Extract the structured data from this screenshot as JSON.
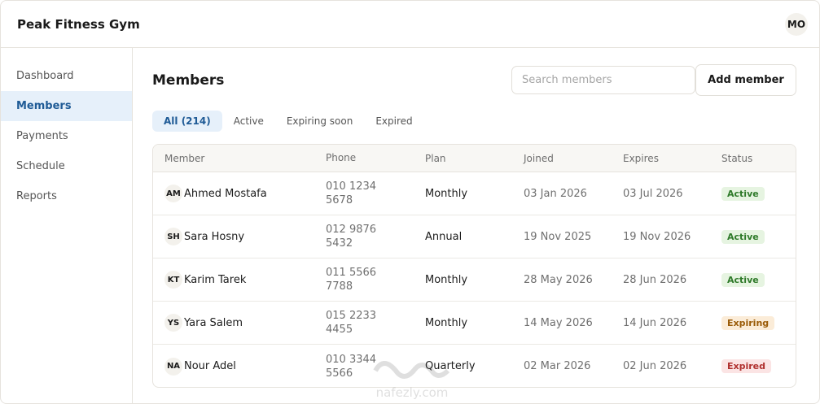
{
  "header": {
    "title": "Peak Fitness Gym",
    "user_initials": "MO"
  },
  "sidebar": {
    "items": [
      {
        "label": "Dashboard",
        "active": false
      },
      {
        "label": "Members",
        "active": true
      },
      {
        "label": "Payments",
        "active": false
      },
      {
        "label": "Schedule",
        "active": false
      },
      {
        "label": "Reports",
        "active": false
      }
    ]
  },
  "main": {
    "title": "Members",
    "search": {
      "placeholder": "Search members",
      "value": ""
    },
    "add_button": "Add member",
    "tabs": [
      {
        "label": "All (214)",
        "active": true
      },
      {
        "label": "Active",
        "active": false
      },
      {
        "label": "Expiring soon",
        "active": false
      },
      {
        "label": "Expired",
        "active": false
      }
    ],
    "table": {
      "columns": [
        "Member",
        "Phone",
        "Plan",
        "Joined",
        "Expires",
        "Status"
      ],
      "rows": [
        {
          "initials": "AM",
          "name": "Ahmed Mostafa",
          "phone_1": "010 1234",
          "phone_2": "5678",
          "plan": "Monthly",
          "joined": "03 Jan 2026",
          "expires": "03 Jul 2026",
          "status": "Active",
          "status_kind": "active"
        },
        {
          "initials": "SH",
          "name": "Sara Hosny",
          "phone_1": "012 9876",
          "phone_2": "5432",
          "plan": "Annual",
          "joined": "19 Nov 2025",
          "expires": "19 Nov 2026",
          "status": "Active",
          "status_kind": "active"
        },
        {
          "initials": "KT",
          "name": "Karim Tarek",
          "phone_1": "011 5566",
          "phone_2": "7788",
          "plan": "Monthly",
          "joined": "28 May 2026",
          "expires": "28 Jun 2026",
          "status": "Active",
          "status_kind": "active"
        },
        {
          "initials": "YS",
          "name": "Yara Salem",
          "phone_1": "015 2233",
          "phone_2": "4455",
          "plan": "Monthly",
          "joined": "14 May 2026",
          "expires": "14 Jun 2026",
          "status": "Expiring",
          "status_kind": "expiring"
        },
        {
          "initials": "NA",
          "name": "Nour Adel",
          "phone_1": "010 3344",
          "phone_2": "5566",
          "plan": "Quarterly",
          "joined": "02 Mar 2026",
          "expires": "02 Jun 2026",
          "status": "Expired",
          "status_kind": "expired"
        }
      ]
    }
  },
  "watermark": {
    "text": "nafezly.com"
  },
  "colors": {
    "accent": "#1f5b96",
    "accent_bg": "#e6f0fa",
    "active_green": "#2f7a2a",
    "expiring_orange": "#9a5b08",
    "expired_red": "#b0302e"
  }
}
